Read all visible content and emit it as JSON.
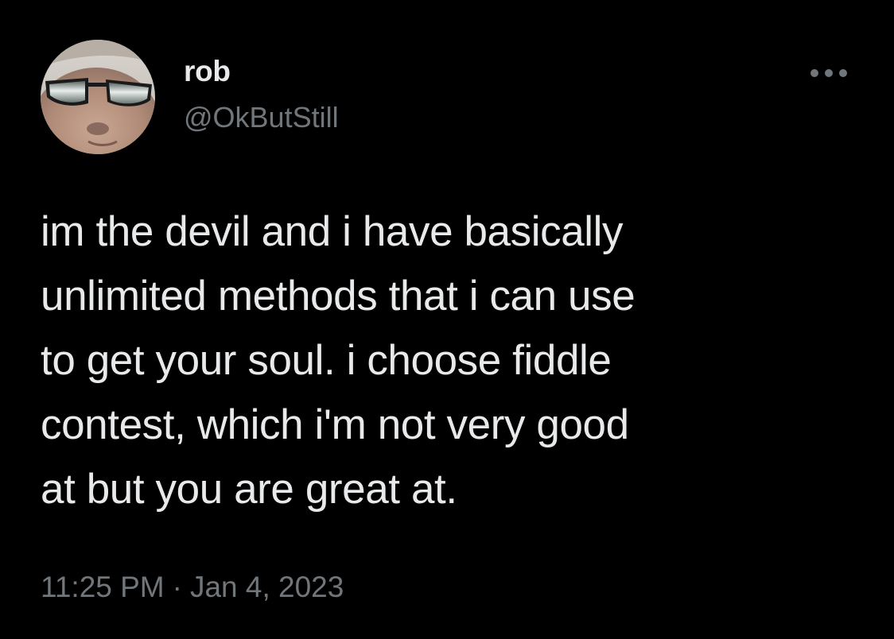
{
  "author": {
    "display_name": "rob",
    "handle": "@OkButStill",
    "avatar_icon": "avatar-photo-sunglasses"
  },
  "more_icon": "more-horizontal-icon",
  "tweet": {
    "lines": [
      "im the devil and i have basically",
      "unlimited methods that i can use",
      "to get your soul. i choose fiddle",
      "contest, which i'm not very good",
      "at but you are great at."
    ]
  },
  "meta": {
    "time": "11:25 PM",
    "separator": "·",
    "date": "Jan 4, 2023"
  },
  "colors": {
    "background": "#000000",
    "primary_text": "#e7e9ea",
    "secondary_text": "#71767b"
  }
}
